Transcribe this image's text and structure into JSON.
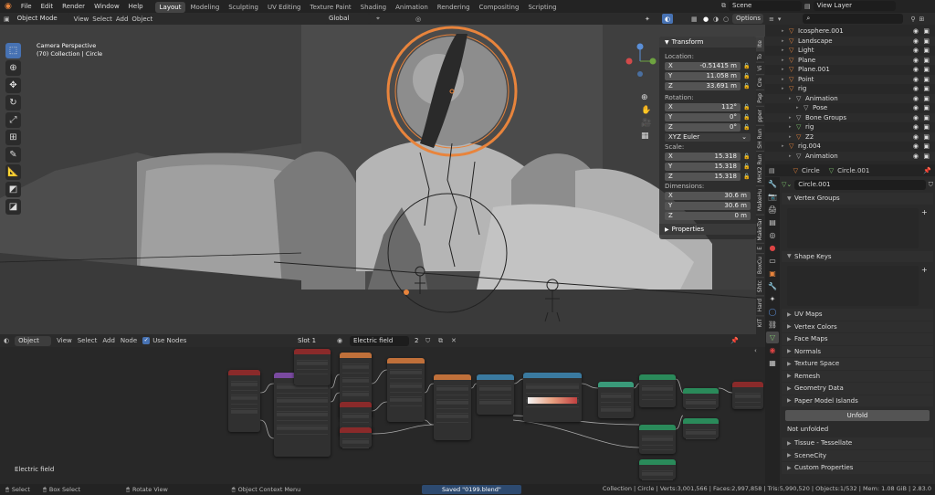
{
  "topbar": {
    "menus": [
      "File",
      "Edit",
      "Render",
      "Window",
      "Help"
    ],
    "workspaces": [
      "Layout",
      "Modeling",
      "Sculpting",
      "UV Editing",
      "Texture Paint",
      "Shading",
      "Animation",
      "Rendering",
      "Compositing",
      "Scripting"
    ],
    "active_workspace": "Layout",
    "scene": "Scene",
    "view_layer": "View Layer"
  },
  "viewport_header": {
    "mode": "Object Mode",
    "menus": [
      "View",
      "Select",
      "Add",
      "Object"
    ],
    "orientation": "Global",
    "options": "Options"
  },
  "viewport": {
    "view_name": "Camera Perspective",
    "collection_info": "(70) Collection | Circle"
  },
  "npanel": {
    "transform_title": "Transform",
    "location_label": "Location:",
    "location": [
      {
        "axis": "X",
        "value": "-0.51415 m"
      },
      {
        "axis": "Y",
        "value": "11.058 m"
      },
      {
        "axis": "Z",
        "value": "33.691 m"
      }
    ],
    "rotation_label": "Rotation:",
    "rotation": [
      {
        "axis": "X",
        "value": "112°"
      },
      {
        "axis": "Y",
        "value": "0°"
      },
      {
        "axis": "Z",
        "value": "0°"
      }
    ],
    "rotation_mode": "XYZ Euler",
    "scale_label": "Scale:",
    "scale": [
      {
        "axis": "X",
        "value": "15.318"
      },
      {
        "axis": "Y",
        "value": "15.318"
      },
      {
        "axis": "Z",
        "value": "15.318"
      }
    ],
    "dimensions_label": "Dimensions:",
    "dimensions": [
      {
        "axis": "X",
        "value": "30.6 m"
      },
      {
        "axis": "Y",
        "value": "30.6 m"
      },
      {
        "axis": "Z",
        "value": "0 m"
      }
    ],
    "properties_title": "Properties"
  },
  "sidebar_tabs": [
    "Ite",
    "To",
    "Vi",
    "Cre",
    "Pap",
    "pper",
    "SH Run",
    "MHX2 Run",
    "MakeHu",
    "MakeTar",
    "E",
    "BoxCu",
    "Shtc",
    "Hard",
    "KIT"
  ],
  "node_header": {
    "editor": "Object",
    "menus": [
      "View",
      "Select",
      "Add",
      "Node"
    ],
    "use_nodes": "Use Nodes",
    "slot": "Slot 1",
    "material": "Electric field",
    "users": "2"
  },
  "node_editor": {
    "material_label": "Electric field"
  },
  "outliner": {
    "items": [
      {
        "name": "Icosphere.001",
        "indent": 1,
        "color": "#e8843c"
      },
      {
        "name": "Landscape",
        "indent": 1,
        "color": "#e8843c"
      },
      {
        "name": "Light",
        "indent": 1,
        "color": "#e8843c"
      },
      {
        "name": "Plane",
        "indent": 1,
        "color": "#e8843c"
      },
      {
        "name": "Plane.001",
        "indent": 1,
        "color": "#e8843c"
      },
      {
        "name": "Point",
        "indent": 1,
        "color": "#e8843c"
      },
      {
        "name": "rig",
        "indent": 1,
        "color": "#e8843c"
      },
      {
        "name": "Animation",
        "indent": 2,
        "color": "#bbbbbb"
      },
      {
        "name": "Pose",
        "indent": 3,
        "color": "#bbbbbb"
      },
      {
        "name": "Bone Groups",
        "indent": 2,
        "color": "#bbbbbb"
      },
      {
        "name": "rig",
        "indent": 2,
        "color": "#7ec36e"
      },
      {
        "name": "Z2",
        "indent": 2,
        "color": "#e8843c"
      },
      {
        "name": "rig.004",
        "indent": 1,
        "color": "#e8843c"
      },
      {
        "name": "Animation",
        "indent": 2,
        "color": "#bbbbbb"
      }
    ]
  },
  "properties": {
    "object_name": "Circle",
    "data_name": "Circle.001",
    "mesh_field": "Circle.001",
    "sections": [
      "Vertex Groups",
      "Shape Keys",
      "UV Maps",
      "Vertex Colors",
      "Face Maps",
      "Normals",
      "Texture Space",
      "Remesh",
      "Geometry Data",
      "Paper Model Islands"
    ],
    "unfold_button": "Unfold",
    "not_unfolded": "Not unfolded",
    "sections_after": [
      "Tissue - Tessellate",
      "SceneCity",
      "Custom Properties"
    ]
  },
  "status": {
    "items": [
      "Select",
      "Box Select",
      "Rotate View",
      "Object Context Menu"
    ],
    "saved": "Saved \"0199.blend\"",
    "stats": "Collection | Circle | Verts:3,001,566 | Faces:2,997,858 | Tris:5,990,520 | Objects:1/532 | Mem: 1.08 GiB | 2.83.0"
  },
  "colors": {
    "accent": "#4772b3",
    "selected": "#e8843c",
    "panel": "#2b2b2b"
  }
}
